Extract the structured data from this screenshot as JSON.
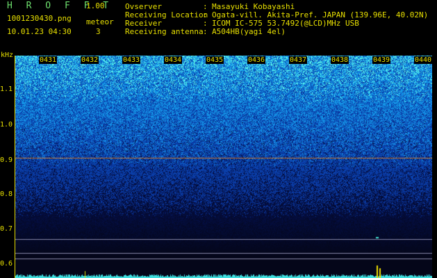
{
  "header": {
    "title": "H R O F F T",
    "version": "1.00",
    "filename": "1001230430.png",
    "datetime": "10.01.23 04:30",
    "meteor_label": "meteor",
    "meteor_count": "3",
    "info": [
      {
        "label": "Ovserver",
        "value": "Masayuki Kobayashi"
      },
      {
        "label": "Receiving Location",
        "value": "Ogata-vill. Akita-Pref. JAPAN (139.96E, 40.02N)"
      },
      {
        "label": "Receiver",
        "value": "ICOM IC-575 53.7492(@LCD)MHz USB"
      },
      {
        "label": "Receiving antenna",
        "value": "A504HB(yagi 4el)"
      }
    ],
    "colon": ":"
  },
  "chart_data": {
    "type": "heatmap",
    "ylabel": "kHz",
    "y_ticks": [
      "1.1",
      "1.0",
      "0.9",
      "0.8",
      "0.7",
      "0.6"
    ],
    "x_ticks": [
      "0431",
      "0432",
      "0433",
      "0434",
      "0435",
      "0436",
      "0437",
      "0438",
      "0439",
      "0440"
    ],
    "reference_line_khz": 0.888,
    "colors": {
      "low": "#0a1450",
      "mid": "#1f5bd8",
      "high": "#3fe0d0",
      "line": "#c87830",
      "axis": "#e8e000"
    }
  }
}
